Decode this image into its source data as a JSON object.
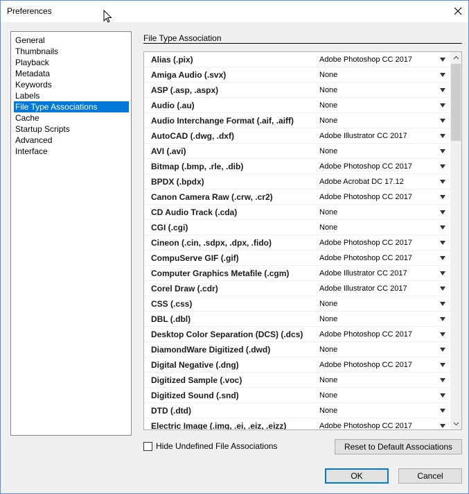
{
  "window": {
    "title": "Preferences"
  },
  "sidebar": {
    "items": [
      {
        "label": "General",
        "selected": false
      },
      {
        "label": "Thumbnails",
        "selected": false
      },
      {
        "label": "Playback",
        "selected": false
      },
      {
        "label": "Metadata",
        "selected": false
      },
      {
        "label": "Keywords",
        "selected": false
      },
      {
        "label": "Labels",
        "selected": false
      },
      {
        "label": "File Type Associations",
        "selected": true
      },
      {
        "label": "Cache",
        "selected": false
      },
      {
        "label": "Startup Scripts",
        "selected": false
      },
      {
        "label": "Advanced",
        "selected": false
      },
      {
        "label": "Interface",
        "selected": false
      }
    ]
  },
  "main": {
    "section_title": "File Type Association",
    "associations": [
      {
        "name": "Alias (.pix)",
        "app": "Adobe Photoshop CC 2017"
      },
      {
        "name": "Amiga Audio (.svx)",
        "app": "None"
      },
      {
        "name": "ASP (.asp, .aspx)",
        "app": "None"
      },
      {
        "name": "Audio (.au)",
        "app": "None"
      },
      {
        "name": "Audio Interchange Format (.aif, .aiff)",
        "app": "None"
      },
      {
        "name": "AutoCAD (.dwg, .dxf)",
        "app": "Adobe Illustrator CC 2017"
      },
      {
        "name": "AVI (.avi)",
        "app": "None"
      },
      {
        "name": "Bitmap (.bmp, .rle, .dib)",
        "app": "Adobe Photoshop CC 2017"
      },
      {
        "name": "BPDX (.bpdx)",
        "app": "Adobe Acrobat DC 17.12"
      },
      {
        "name": "Canon Camera Raw (.crw, .cr2)",
        "app": "Adobe Photoshop CC 2017"
      },
      {
        "name": "CD Audio Track (.cda)",
        "app": "None"
      },
      {
        "name": "CGI (.cgi)",
        "app": "None"
      },
      {
        "name": "Cineon (.cin, .sdpx, .dpx, .fido)",
        "app": "Adobe Photoshop CC 2017"
      },
      {
        "name": "CompuServe GIF (.gif)",
        "app": "Adobe Photoshop CC 2017"
      },
      {
        "name": "Computer Graphics Metafile (.cgm)",
        "app": "Adobe Illustrator CC 2017"
      },
      {
        "name": "Corel Draw (.cdr)",
        "app": "Adobe Illustrator CC 2017"
      },
      {
        "name": "CSS (.css)",
        "app": "None"
      },
      {
        "name": "DBL (.dbl)",
        "app": "None"
      },
      {
        "name": "Desktop Color Separation (DCS) (.dcs)",
        "app": "Adobe Photoshop CC 2017"
      },
      {
        "name": "DiamondWare Digitized (.dwd)",
        "app": "None"
      },
      {
        "name": "Digital Negative (.dng)",
        "app": "Adobe Photoshop CC 2017"
      },
      {
        "name": "Digitized Sample (.voc)",
        "app": "None"
      },
      {
        "name": "Digitized Sound (.snd)",
        "app": "None"
      },
      {
        "name": "DTD (.dtd)",
        "app": "None"
      },
      {
        "name": "Electric Image (.img, .ei, .eiz, .eizz)",
        "app": "Adobe Photoshop CC 2017"
      }
    ]
  },
  "footer": {
    "hide_undefined_label": "Hide Undefined File Associations",
    "hide_undefined_checked": false,
    "reset_label": "Reset to Default Associations",
    "ok_label": "OK",
    "cancel_label": "Cancel"
  },
  "colors": {
    "selection": "#0078d7",
    "window_border": "#5a8fd8"
  },
  "icons": {
    "close": "close-icon",
    "dropdown": "dropdown-arrow-icon",
    "cursor": "mouse-cursor-icon"
  }
}
